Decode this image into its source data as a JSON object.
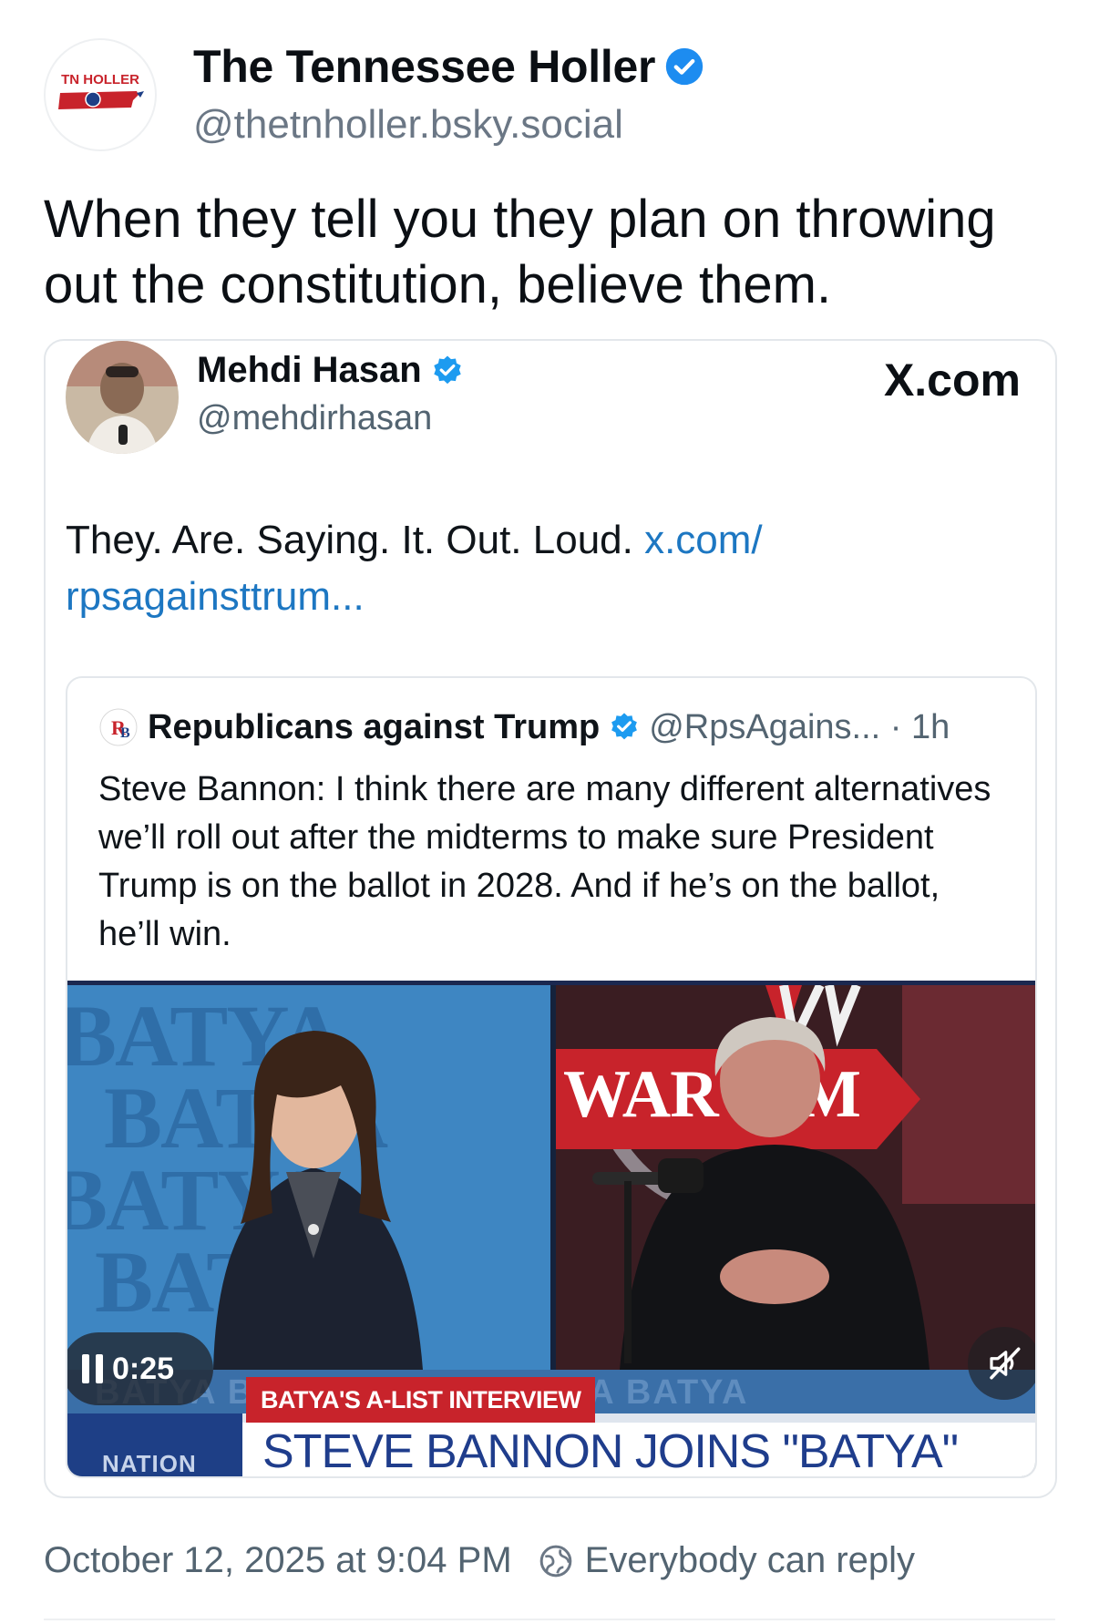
{
  "post": {
    "author_name": "The Tennessee Holler",
    "author_handle": "@thetnholler.bsky.social",
    "avatar_logo_text": "TN HOLLER",
    "text": "When they tell you they plan on throwing out the constitution, believe them.",
    "timestamp": "October 12, 2025 at 9:04 PM",
    "reply_setting": "Everybody can reply"
  },
  "embed": {
    "author_name": "Mehdi Hasan",
    "author_handle": "@mehdirhasan",
    "source": "X.com",
    "text": "They. Are. Saying. It. Out. Loud. ",
    "link_text": "x.com/\nrpsagainsttrum...",
    "quote": {
      "author_name": "Republicans against Trump",
      "meta": "@RpsAgains... · 1h",
      "avatar_text": "RB",
      "text": "Steve Bannon: I think there are many different alternatives we’ll roll out after the midterms to make sure President Trump is on the ballot in 2028. And if he’s on the ballot, he’ll win."
    },
    "video": {
      "time": "0:25",
      "bg_word_left": "BATYA",
      "banner_right": "WAR R   M",
      "lower_third_strip": "BATYA   BATYA   BATYA   BATYA   BATYA",
      "lower_third_label": "BATYA'S A-LIST INTERVIEW",
      "headline": "STEVE BANNON JOINS \"BATYA\"",
      "network": "NATION"
    }
  },
  "colors": {
    "verified": "#1d8cf0",
    "link": "#1d77c2",
    "muted": "#536471"
  }
}
